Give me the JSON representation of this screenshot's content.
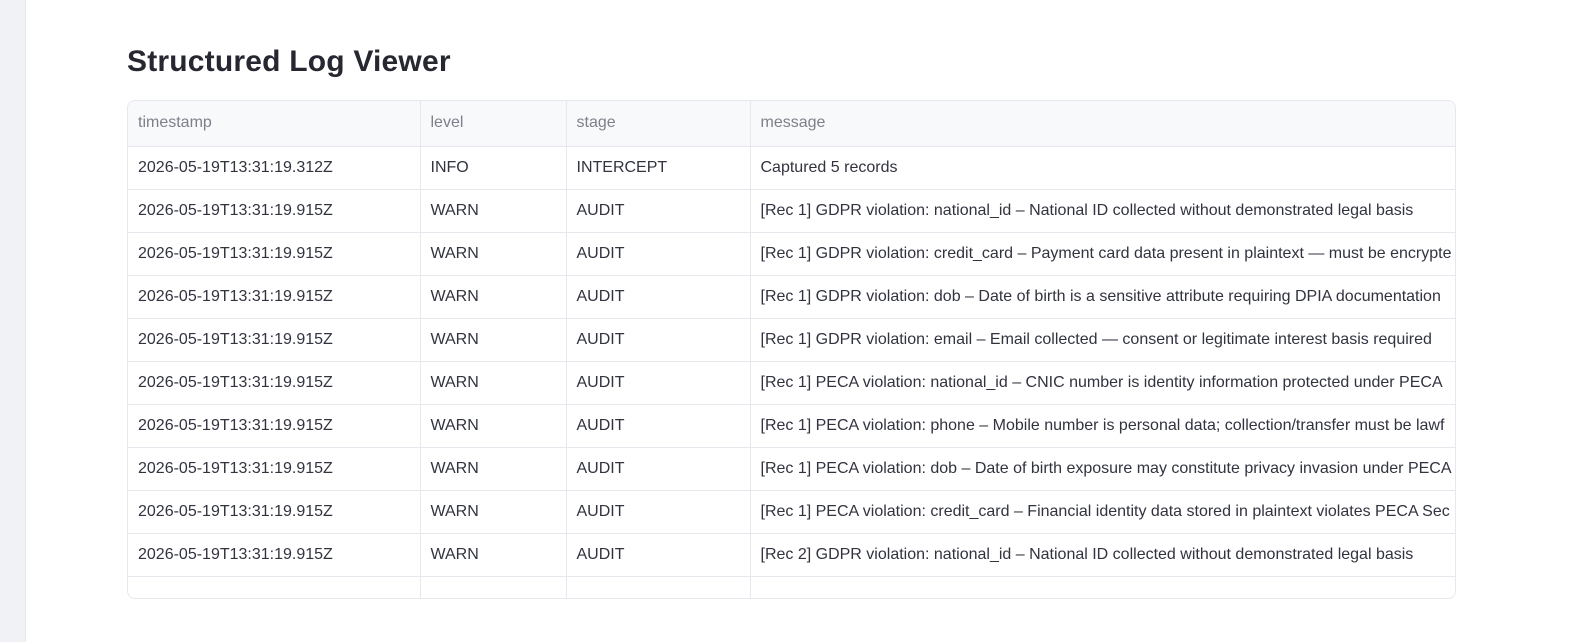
{
  "page": {
    "title": "Structured Log Viewer"
  },
  "table": {
    "columns": [
      "timestamp",
      "level",
      "stage",
      "message"
    ],
    "rows": [
      {
        "timestamp": "2026-05-19T13:31:19.312Z",
        "level": "INFO",
        "stage": "INTERCEPT",
        "message": "Captured 5 records"
      },
      {
        "timestamp": "2026-05-19T13:31:19.915Z",
        "level": "WARN",
        "stage": "AUDIT",
        "message": "[Rec 1] GDPR violation: national_id – National ID collected without demonstrated legal basis"
      },
      {
        "timestamp": "2026-05-19T13:31:19.915Z",
        "level": "WARN",
        "stage": "AUDIT",
        "message": "[Rec 1] GDPR violation: credit_card – Payment card data present in plaintext — must be encrypte"
      },
      {
        "timestamp": "2026-05-19T13:31:19.915Z",
        "level": "WARN",
        "stage": "AUDIT",
        "message": "[Rec 1] GDPR violation: dob – Date of birth is a sensitive attribute requiring DPIA documentation"
      },
      {
        "timestamp": "2026-05-19T13:31:19.915Z",
        "level": "WARN",
        "stage": "AUDIT",
        "message": "[Rec 1] GDPR violation: email – Email collected — consent or legitimate interest basis required"
      },
      {
        "timestamp": "2026-05-19T13:31:19.915Z",
        "level": "WARN",
        "stage": "AUDIT",
        "message": "[Rec 1] PECA violation: national_id – CNIC number is identity information protected under PECA"
      },
      {
        "timestamp": "2026-05-19T13:31:19.915Z",
        "level": "WARN",
        "stage": "AUDIT",
        "message": "[Rec 1] PECA violation: phone – Mobile number is personal data; collection/transfer must be lawf"
      },
      {
        "timestamp": "2026-05-19T13:31:19.915Z",
        "level": "WARN",
        "stage": "AUDIT",
        "message": "[Rec 1] PECA violation: dob – Date of birth exposure may constitute privacy invasion under PECA"
      },
      {
        "timestamp": "2026-05-19T13:31:19.915Z",
        "level": "WARN",
        "stage": "AUDIT",
        "message": "[Rec 1] PECA violation: credit_card – Financial identity data stored in plaintext violates PECA Sec"
      },
      {
        "timestamp": "2026-05-19T13:31:19.915Z",
        "level": "WARN",
        "stage": "AUDIT",
        "message": "[Rec 2] GDPR violation: national_id – National ID collected without demonstrated legal basis"
      }
    ]
  }
}
